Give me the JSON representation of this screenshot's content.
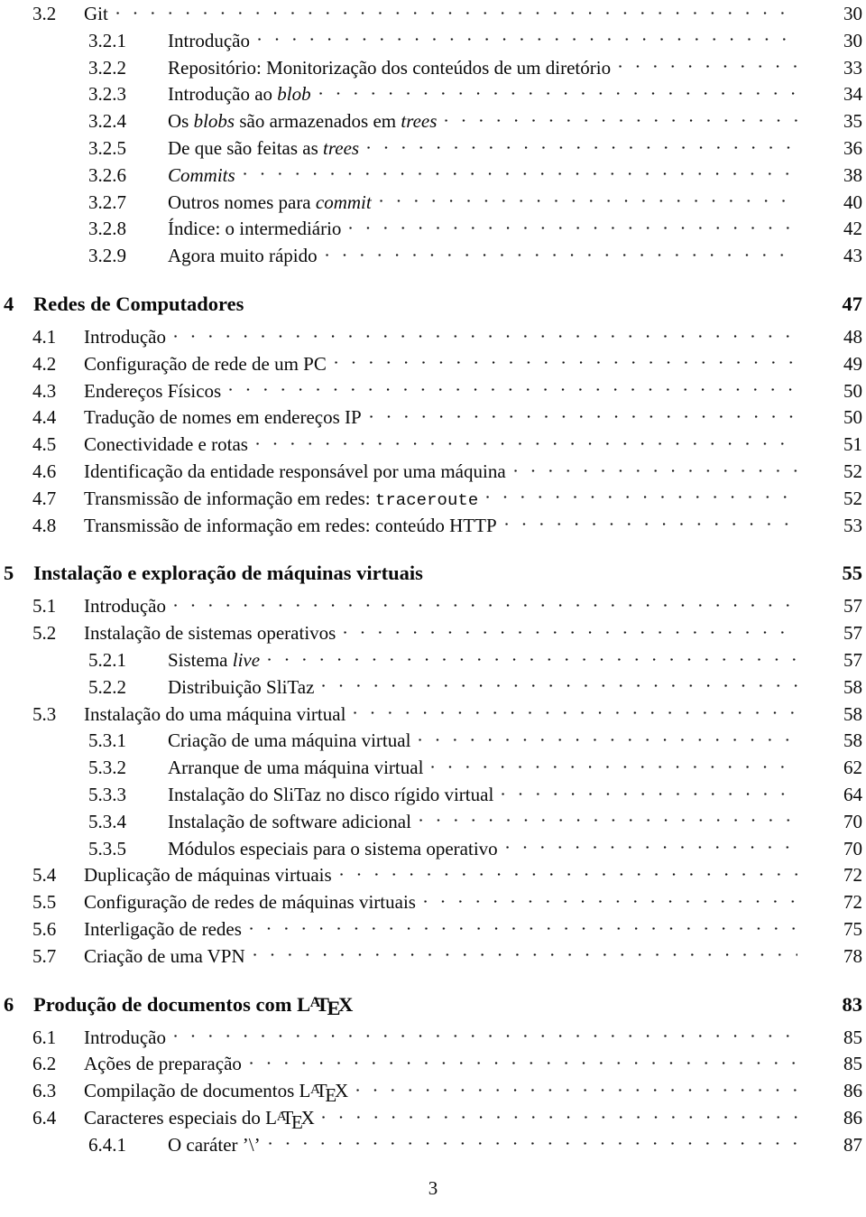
{
  "page": {
    "folio": "3",
    "kind": "table-of-contents"
  },
  "entries": [
    {
      "level": "section",
      "number": "3.2",
      "title": "Git",
      "page": "30"
    },
    {
      "level": "subsection",
      "number": "3.2.1",
      "title": "Introdução",
      "page": "30"
    },
    {
      "level": "subsection",
      "number": "3.2.2",
      "title": "Repositório: Monitorização dos conteúdos de um diretório",
      "page": "33"
    },
    {
      "level": "subsection",
      "number": "3.2.3",
      "title": "Introdução ao blob",
      "page": "34"
    },
    {
      "level": "subsection",
      "number": "3.2.4",
      "title": "Os blobs são armazenados em trees",
      "page": "35"
    },
    {
      "level": "subsection",
      "number": "3.2.5",
      "title": "De que são feitas as trees",
      "page": "36"
    },
    {
      "level": "subsection",
      "number": "3.2.6",
      "title": "Commits",
      "page": "38"
    },
    {
      "level": "subsection",
      "number": "3.2.7",
      "title": "Outros nomes para commit",
      "page": "40"
    },
    {
      "level": "subsection",
      "number": "3.2.8",
      "title": "Índice: o intermediário",
      "page": "42"
    },
    {
      "level": "subsection",
      "number": "3.2.9",
      "title": "Agora muito rápido",
      "page": "43"
    },
    {
      "level": "chapter",
      "number": "4",
      "title": "Redes de Computadores",
      "page": "47"
    },
    {
      "level": "section",
      "number": "4.1",
      "title": "Introdução",
      "page": "48"
    },
    {
      "level": "section",
      "number": "4.2",
      "title": "Configuração de rede de um PC",
      "page": "49"
    },
    {
      "level": "section",
      "number": "4.3",
      "title": "Endereços Físicos",
      "page": "50"
    },
    {
      "level": "section",
      "number": "4.4",
      "title": "Tradução de nomes em endereços IP",
      "page": "50"
    },
    {
      "level": "section",
      "number": "4.5",
      "title": "Conectividade e rotas",
      "page": "51"
    },
    {
      "level": "section",
      "number": "4.6",
      "title": "Identificação da entidade responsável por uma máquina",
      "page": "52"
    },
    {
      "level": "section",
      "number": "4.7",
      "title": "Transmissão de informação em redes: traceroute",
      "page": "52"
    },
    {
      "level": "section",
      "number": "4.8",
      "title": "Transmissão de informação em redes: conteúdo HTTP",
      "page": "53"
    },
    {
      "level": "chapter",
      "number": "5",
      "title": "Instalação e exploração de máquinas virtuais",
      "page": "55"
    },
    {
      "level": "section",
      "number": "5.1",
      "title": "Introdução",
      "page": "57"
    },
    {
      "level": "section",
      "number": "5.2",
      "title": "Instalação de sistemas operativos",
      "page": "57"
    },
    {
      "level": "subsection",
      "number": "5.2.1",
      "title": "Sistema live",
      "page": "57"
    },
    {
      "level": "subsection",
      "number": "5.2.2",
      "title": "Distribuição SliTaz",
      "page": "58"
    },
    {
      "level": "section",
      "number": "5.3",
      "title": "Instalação do uma máquina virtual",
      "page": "58"
    },
    {
      "level": "subsection",
      "number": "5.3.1",
      "title": "Criação de uma máquina virtual",
      "page": "58"
    },
    {
      "level": "subsection",
      "number": "5.3.2",
      "title": "Arranque de uma máquina virtual",
      "page": "62"
    },
    {
      "level": "subsection",
      "number": "5.3.3",
      "title": "Instalação do SliTaz no disco rígido virtual",
      "page": "64"
    },
    {
      "level": "subsection",
      "number": "5.3.4",
      "title": "Instalação de software adicional",
      "page": "70"
    },
    {
      "level": "subsection",
      "number": "5.3.5",
      "title": "Módulos especiais para o sistema operativo",
      "page": "70"
    },
    {
      "level": "section",
      "number": "5.4",
      "title": "Duplicação de máquinas virtuais",
      "page": "72"
    },
    {
      "level": "section",
      "number": "5.5",
      "title": "Configuração de redes de máquinas virtuais",
      "page": "72"
    },
    {
      "level": "section",
      "number": "5.6",
      "title": "Interligação de redes",
      "page": "75"
    },
    {
      "level": "section",
      "number": "5.7",
      "title": "Criação de uma VPN",
      "page": "78"
    },
    {
      "level": "chapter",
      "number": "6",
      "title": "Produção de documentos com LaTeX",
      "page": "83"
    },
    {
      "level": "section",
      "number": "6.1",
      "title": "Introdução",
      "page": "85"
    },
    {
      "level": "section",
      "number": "6.2",
      "title": "Ações de preparação",
      "page": "85"
    },
    {
      "level": "section",
      "number": "6.3",
      "title": "Compilação de documentos LaTeX",
      "page": "86"
    },
    {
      "level": "section",
      "number": "6.4",
      "title": "Caracteres especiais do LaTeX",
      "page": "86"
    },
    {
      "level": "subsection",
      "number": "6.4.1",
      "title": "O caráter ’\\’",
      "page": "87"
    }
  ],
  "formatting": {
    "italic_words": [
      "blob",
      "blobs",
      "trees",
      "Commits",
      "commit",
      "live"
    ],
    "mono_words": [
      "traceroute"
    ],
    "latex_token": "LaTeX"
  }
}
